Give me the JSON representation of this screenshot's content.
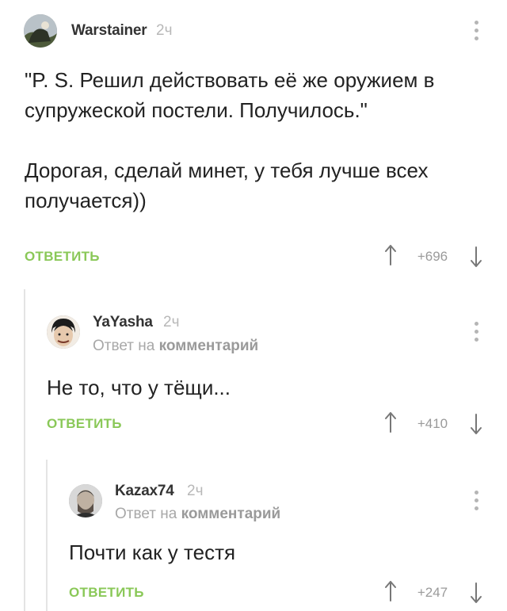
{
  "comments": [
    {
      "author": "Warstainer",
      "time": "2ч",
      "text": "\"P. S. Решил действовать её же оружием в супружеской постели. Получилось.\"\n\nДорогая, сделай минет, у тебя лучше всех получается))",
      "reply_label": "ОТВЕТИТЬ",
      "score": "+696"
    },
    {
      "author": "YaYasha",
      "time": "2ч",
      "reply_prefix": "Ответ на",
      "reply_target": "комментарий",
      "text": "Не то, что у тёщи...",
      "reply_label": "ОТВЕТИТЬ",
      "score": "+410"
    },
    {
      "author": "Kazax74",
      "time": "2ч",
      "reply_prefix": "Ответ на",
      "reply_target": "комментарий",
      "text": "Почти как у тестя",
      "reply_label": "ОТВЕТИТЬ",
      "score": "+247"
    }
  ],
  "icons": {
    "menu": "more-vertical-icon",
    "upvote": "arrow-up-icon",
    "downvote": "arrow-down-icon"
  },
  "colors": {
    "accent": "#8ac858",
    "muted": "#9a9a9a",
    "thread_line": "#e4e4e4"
  }
}
